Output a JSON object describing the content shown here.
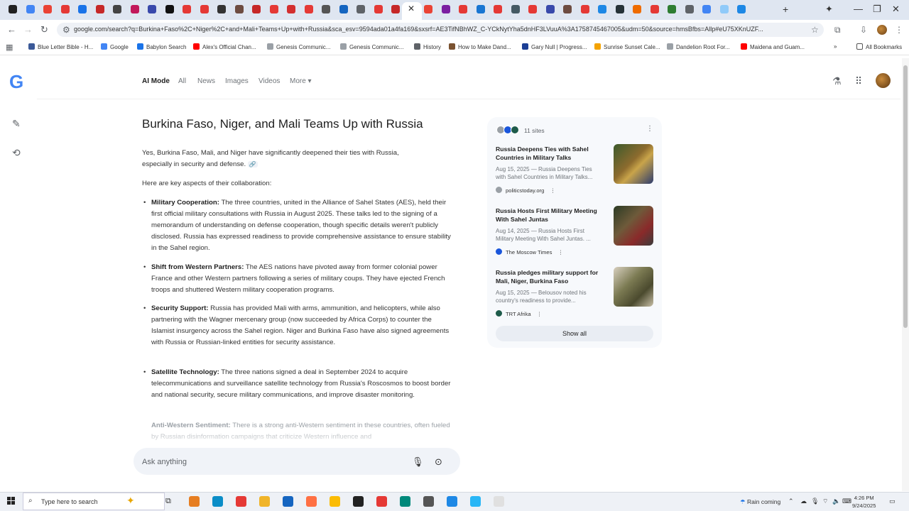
{
  "browser": {
    "url": "google.com/search?q=Burkina+Faso%2C+Niger%2C+and+Mali+Teams+Up+with+Russia&sca_esv=9594ada01a4fa169&sxsrf=AE3TifNBhWZ_C-YCkNytYha5dnHF3LVuuA%3A1758745467005&udm=50&source=hmsBfbs=Allp#eU75XKnUZF...",
    "bookmarks": [
      {
        "label": "Blue Letter Bible - H...",
        "color": "#3b5998"
      },
      {
        "label": "Google",
        "color": "#4285f4"
      },
      {
        "label": "Babylon Search",
        "color": "#1a73e8"
      },
      {
        "label": "Alex's Official Chan...",
        "color": "#ff0000"
      },
      {
        "label": "Genesis Communic...",
        "color": "#9aa0a6"
      },
      {
        "label": "Genesis Communic...",
        "color": "#9aa0a6"
      },
      {
        "label": "History",
        "color": "#5f6368"
      },
      {
        "label": "How to Make Dand...",
        "color": "#7a5230"
      },
      {
        "label": "Gary Null | Progress...",
        "color": "#1c3f95"
      },
      {
        "label": "Sunrise Sunset Cale...",
        "color": "#f4a300"
      },
      {
        "label": "Dandelion Root For...",
        "color": "#9aa0a6"
      },
      {
        "label": "Maidena and Guam...",
        "color": "#ff0000"
      }
    ],
    "all_bookmarks": "All Bookmarks"
  },
  "google": {
    "logo": "G",
    "tabs": [
      "AI Mode",
      "All",
      "News",
      "Images",
      "Videos",
      "More ▾"
    ]
  },
  "answer": {
    "title": "Burkina Faso, Niger, and Mali Teams Up with Russia",
    "intro_1": "Yes, Burkina Faso, Mali, and Niger have significantly deepened their ties with Russia,",
    "intro_2": "especially in security and defense.",
    "key_aspects": "Here are key aspects of their collaboration:",
    "bullets": [
      {
        "head": "Military Cooperation:",
        "text": " The three countries, united in the Alliance of Sahel States (AES), held their first official military consultations with Russia in August 2025. These talks led to the signing of a memorandum of understanding on defense cooperation, though specific details weren't publicly disclosed. Russia has expressed readiness to provide comprehensive assistance to ensure stability in the Sahel region."
      },
      {
        "head": "Shift from Western Partners:",
        "text": " The AES nations have pivoted away from former colonial power France and other Western partners following a series of military coups. They have ejected French troops and shuttered Western military cooperation programs."
      },
      {
        "head": "Security Support:",
        "text": " Russia has provided Mali with arms, ammunition, and helicopters, while also partnering with the Wagner mercenary group (now succeeded by Africa Corps) to counter the Islamist insurgency across the Sahel region. Niger and Burkina Faso have also signed agreements with Russia or Russian-linked entities for security assistance."
      },
      {
        "head": "Satellite Technology:",
        "text": " The three nations signed a deal in September 2024 to acquire telecommunications and surveillance satellite technology from Russia's Roscosmos to boost border and national security, secure military communications, and improve disaster monitoring."
      },
      {
        "head": "Anti-Western Sentiment:",
        "text": " There is a strong anti-Western sentiment in these countries, often fueled by Russian disinformation campaigns that criticize Western influence and"
      }
    ]
  },
  "ask": {
    "placeholder": "Ask anything"
  },
  "sources": {
    "count_label": "11 sites",
    "items": [
      {
        "title": "Russia Deepens Ties with Sahel Countries in Military Talks",
        "snippet": "Aug 15, 2025 — Russia Deepens Ties\nwith Sahel Countries in Military Talks...",
        "site": "politicstoday.org",
        "site_color": "#9aa0a6"
      },
      {
        "title": "Russia Hosts First Military Meeting With Sahel Juntas",
        "snippet": "Aug 14, 2025 — Russia Hosts First\nMilitary Meeting With Sahel Juntas. ...",
        "site": "The Moscow Times",
        "site_color": "#1a56db"
      },
      {
        "title": "Russia pledges military support for Mali, Niger, Burkina Faso",
        "snippet": "Aug 15, 2025 — Belousov noted his\ncountry's readiness to provide...",
        "site": "TRT Afrika",
        "site_color": "#1e5b4a"
      }
    ],
    "show_all": "Show all"
  },
  "taskbar": {
    "search_placeholder": "Type here to search",
    "weather": "Rain coming",
    "time": "4:26 PM",
    "date": "9/24/2025"
  }
}
